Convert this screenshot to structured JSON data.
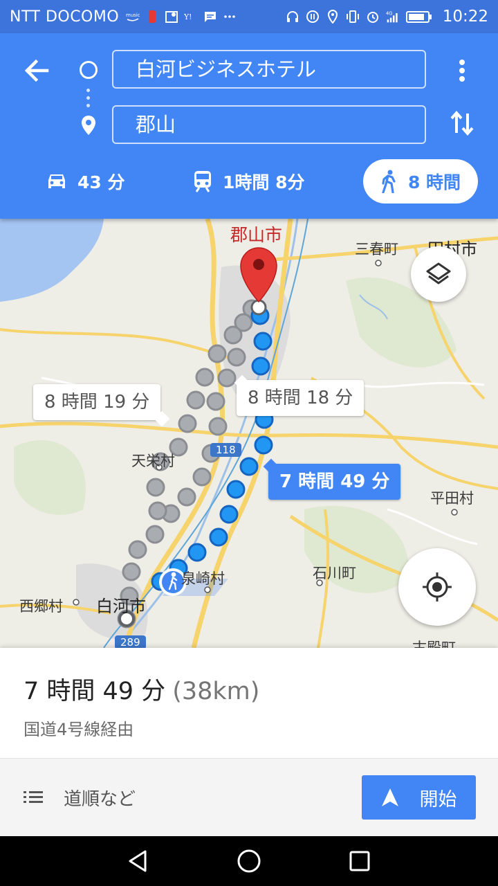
{
  "status_bar": {
    "carrier": "NTT DOCOMO",
    "time": "10:22",
    "network": "4G",
    "icons": [
      "amazon-music-icon",
      "phone-icon",
      "maps-icon",
      "yahoo-icon",
      "message-icon",
      "more-dots-icon",
      "headphones-icon",
      "data-saver-icon",
      "location-icon",
      "vibrate-icon",
      "alarm-icon",
      "signal-icon",
      "battery-icon"
    ]
  },
  "directions": {
    "origin": "白河ビジネスホテル",
    "destination": "郡山",
    "modes": [
      {
        "name": "car",
        "label": "43 分",
        "icon": "car-icon"
      },
      {
        "name": "transit",
        "label": "1時間 8分",
        "icon": "train-icon"
      },
      {
        "name": "walk",
        "label": "8 時間",
        "icon": "walking-icon",
        "selected": true
      }
    ]
  },
  "map": {
    "places": {
      "koriyama": "郡山市",
      "miharu": "三春町",
      "tamura": "田村市",
      "tenei": "天栄村",
      "hirata": "平田村",
      "izumizaki": "泉崎村",
      "ishikawa": "石川町",
      "nishigo": "西郷村",
      "shirakawa": "白河市",
      "furudono": "古殿町"
    },
    "road_118": "118",
    "road_289": "289",
    "callouts": {
      "alt1": "8 時間 19 分",
      "alt2": "8 時間 18 分",
      "primary": "7 時間 49 分"
    }
  },
  "summary": {
    "duration": "7 時間 49 分",
    "distance": "(38km)",
    "via": "国道4号線経由"
  },
  "actions": {
    "steps": "道順など",
    "start": "開始"
  },
  "colors": {
    "header": "#4285f4",
    "status_bar": "#3d74db",
    "route_primary": "#2196f3",
    "route_alt": "#a9adb1",
    "destination_pin": "#e53935"
  }
}
